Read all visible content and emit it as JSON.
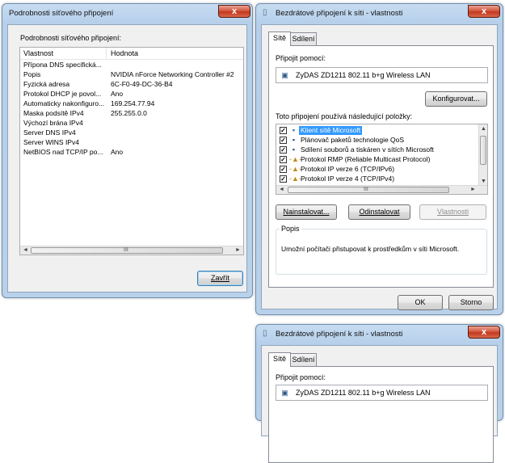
{
  "dialog1": {
    "title": "Podrobnosti síťového připojení",
    "close_label": "x",
    "section_label": "Podrobnosti síťového připojení:",
    "columns": [
      "Vlastnost",
      "Hodnota"
    ],
    "rows": [
      {
        "prop": "Přípona DNS specifická...",
        "value": ""
      },
      {
        "prop": "Popis",
        "value": "NVIDIA nForce Networking Controller #2"
      },
      {
        "prop": "Fyzická adresa",
        "value": "6C-F0-49-DC-36-B4"
      },
      {
        "prop": "Protokol DHCP je povol...",
        "value": "Ano"
      },
      {
        "prop": "Automaticky nakonfiguro...",
        "value": "169.254.77.94"
      },
      {
        "prop": "Maska podsítě IPv4",
        "value": "255.255.0.0"
      },
      {
        "prop": "Výchozí brána IPv4",
        "value": ""
      },
      {
        "prop": "Server DNS IPv4",
        "value": ""
      },
      {
        "prop": "Server WINS IPv4",
        "value": ""
      },
      {
        "prop": "NetBIOS nad TCP/IP po...",
        "value": "Ano"
      }
    ],
    "close_button": "Zavřít"
  },
  "dialog2": {
    "title": "Bezdrátové připojení k síti - vlastnosti",
    "close_label": "x",
    "tabs": [
      "Sítě",
      "Sdílení"
    ],
    "connect_using_label": "Připojit pomocí:",
    "adapter_name": "ZyDAS ZD1211 802.11 b+g Wireless LAN",
    "configure_button": "Konfigurovat...",
    "items_label": "Toto připojení používá následující položky:",
    "items": [
      {
        "label": "Klient sítě Microsoft",
        "checked": true,
        "selected": true,
        "icon": "network-client-icon"
      },
      {
        "label": "Plánovač paketů technologie QoS",
        "checked": true,
        "selected": false,
        "icon": "qos-scheduler-icon"
      },
      {
        "label": "Sdílení souborů a tiskáren v sítích Microsoft",
        "checked": true,
        "selected": false,
        "icon": "file-printer-sharing-icon"
      },
      {
        "label": "Protokol RMP (Reliable Multicast Protocol)",
        "checked": true,
        "selected": false,
        "icon": "protocol-icon"
      },
      {
        "label": "Protokol IP verze 6 (TCP/IPv6)",
        "checked": true,
        "selected": false,
        "icon": "protocol-icon"
      },
      {
        "label": "Protokol IP verze 4 (TCP/IPv4)",
        "checked": true,
        "selected": false,
        "icon": "protocol-icon"
      }
    ],
    "install_button": "Nainstalovat...",
    "uninstall_button": "Odinstalovat",
    "properties_button": "Vlastnosti",
    "description_legend": "Popis",
    "description_text": "Umožní počítači přistupovat k prostředkům v síti Microsoft.",
    "ok_button": "OK",
    "cancel_button": "Storno"
  },
  "dialog3": {
    "title": "Bezdrátové připojení k síti - vlastnosti",
    "close_label": "x",
    "tabs": [
      "Sítě",
      "Sdílení"
    ],
    "connect_using_label": "Připojit pomocí:",
    "adapter_name": "ZyDAS ZD1211 802.11 b+g Wireless LAN"
  },
  "colors": {
    "window_frame": "#b9d1ea",
    "selection": "#3399ff",
    "close_button": "#c7432a"
  }
}
